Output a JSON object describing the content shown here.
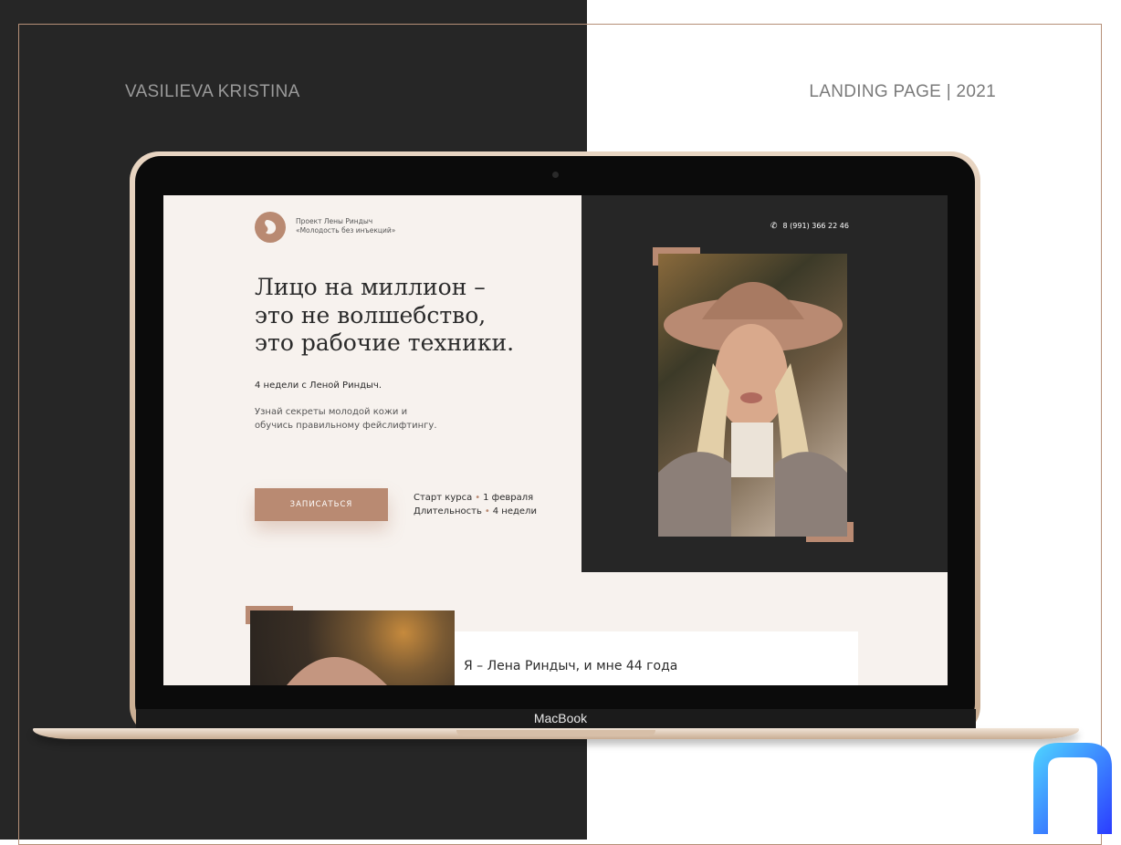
{
  "header": {
    "author": "VASILIEVA KRISTINA",
    "project": "LANDING PAGE | 2021"
  },
  "device": {
    "label": "MacBook"
  },
  "site": {
    "logo_line1": "Проект Лены Риндыч",
    "logo_line2": "«Молодость без инъекций»",
    "phone": "8 (991) 366 22 46",
    "headline_line1": "Лицо на миллион –",
    "headline_line2": "это не волшебство,",
    "headline_line3": "это рабочие техники.",
    "subhead": "4 недели с Леной Риндыч.",
    "desc_line1": "Узнай секреты молодой кожи и",
    "desc_line2": "обучись правильному фейслифтингу.",
    "cta_label": "ЗАПИСАТЬСЯ",
    "start_label": "Старт курса",
    "start_value": "1 февраля",
    "duration_label": "Длительность",
    "duration_value": "4 недели",
    "intro": "Я – Лена Риндыч, и мне 44 года"
  },
  "colors": {
    "accent": "#b98a72",
    "dark": "#262626",
    "light_bg": "#f7f2ee"
  },
  "icons": [
    "phone-icon",
    "logo-icon",
    "brand-mark-icon"
  ]
}
